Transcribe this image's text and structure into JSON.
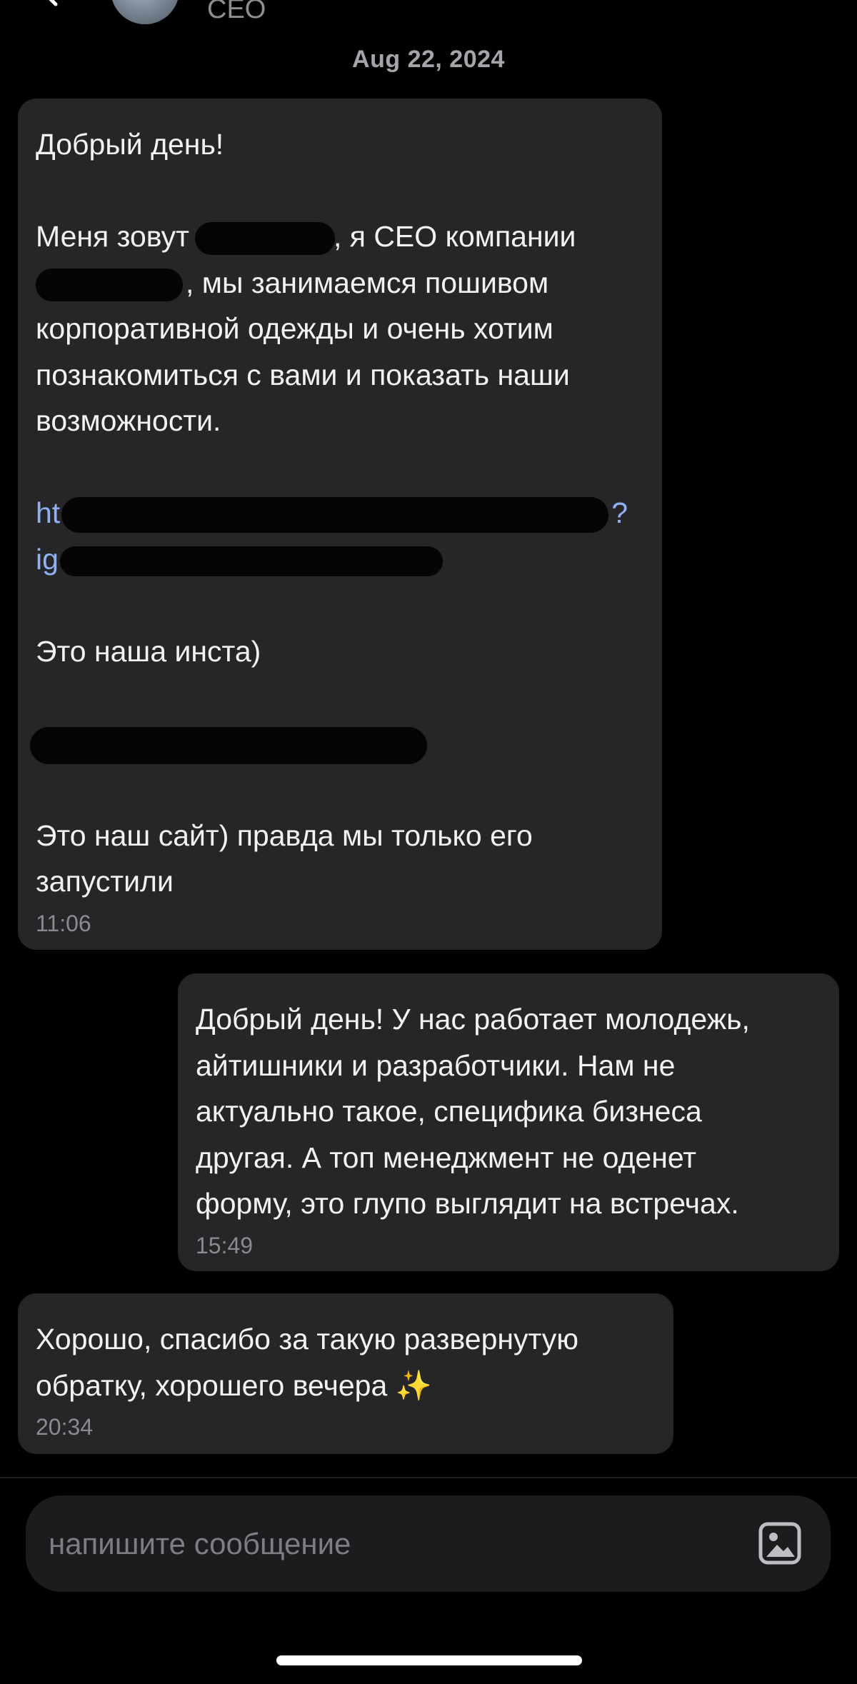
{
  "header": {
    "contact_role": "CEO",
    "back_icon": "chevron-left-icon"
  },
  "conversation": {
    "date_label": "Aug 22, 2024",
    "messages": [
      {
        "direction": "incoming",
        "greeting": "Добрый день!",
        "intro_line_1_a": "Меня зовут",
        "intro_line_1_b": ", я CEO компании",
        "intro_line_2": ", мы занимаемся пошивом",
        "intro_line_3": "корпоративной одежды и очень хотим",
        "intro_line_4": "познакомиться с вами и показать наши",
        "intro_line_5": "возможности.",
        "link_fragment_1": "ht",
        "link_fragment_2": "?",
        "link_fragment_3": "ig",
        "insta_caption": "Это наша инста)",
        "site_caption_line_1": "Это наш сайт) правда мы только его",
        "site_caption_line_2": "запустили",
        "time": "11:06"
      },
      {
        "direction": "outgoing",
        "lines": [
          "Добрый день! У нас работает молодежь,",
          "айтишники и разработчики. Нам не",
          "актуально такое, специфика бизнеса",
          "другая. А топ менеджмент не оденет",
          "форму, это глупо выглядит на встречах."
        ],
        "time": "15:49"
      },
      {
        "direction": "incoming",
        "lines": [
          "Хорошо, спасибо за такую развернутую",
          "обратку, хорошего вечера ✨"
        ],
        "time": "20:34"
      }
    ]
  },
  "composer": {
    "placeholder": "напишите сообщение",
    "value": "",
    "attach_icon": "image-icon"
  },
  "colors": {
    "background": "#000000",
    "bubble": "#262628",
    "link": "#8fb0f2",
    "timestamp": "#8a8a8f"
  }
}
